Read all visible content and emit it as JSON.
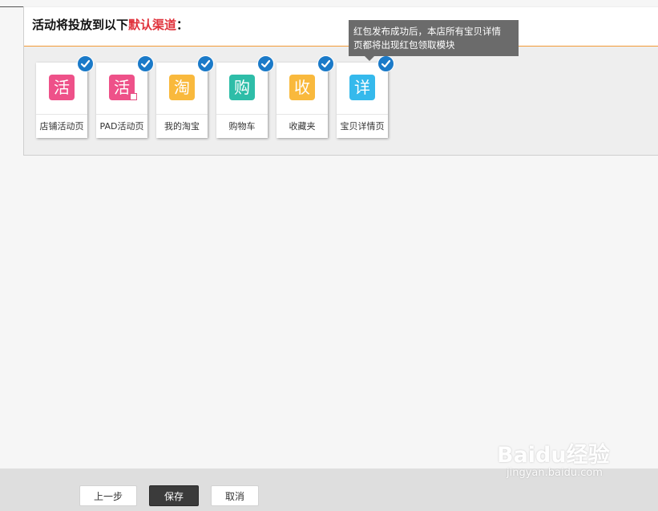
{
  "header": {
    "title_prefix": "活动将投放到以下",
    "title_highlight": "默认渠道",
    "title_suffix": "："
  },
  "channels": [
    {
      "label": "店铺活动页",
      "glyph": "活",
      "color": "#ee5189",
      "checked": true
    },
    {
      "label": "PAD活动页",
      "glyph": "活",
      "color": "#ee5189",
      "checked": true
    },
    {
      "label": "我的淘宝",
      "glyph": "淘",
      "color": "#f9b93d",
      "checked": true
    },
    {
      "label": "购物车",
      "glyph": "购",
      "color": "#2ebda8",
      "checked": true
    },
    {
      "label": "收藏夹",
      "glyph": "收",
      "color": "#f9b93d",
      "checked": true
    },
    {
      "label": "宝贝详情页",
      "glyph": "详",
      "color": "#35b9ec",
      "checked": true
    }
  ],
  "tooltip": {
    "line1": "红包发布成功后，本店所有宝贝详情",
    "line2": "页都将出现红包领取模块"
  },
  "footer": {
    "prev_label": "上一步",
    "save_label": "保存",
    "cancel_label": "取消"
  },
  "watermark": {
    "main": "Baidu经验",
    "sub": "jingyan.baidu.com"
  },
  "colors": {
    "accent": "#f29a36",
    "highlight": "#e0313b",
    "check": "#1b7ac8"
  }
}
